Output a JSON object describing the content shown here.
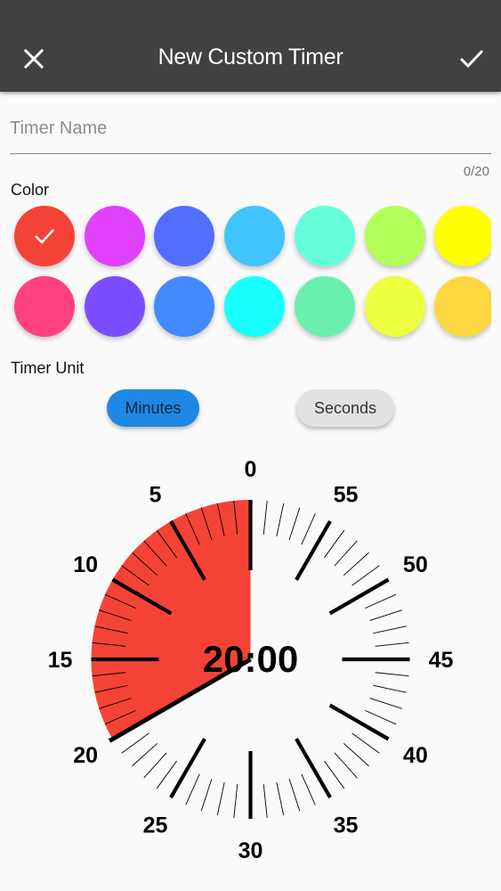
{
  "appbar": {
    "title": "New Custom Timer",
    "close_icon": "close-icon",
    "confirm_icon": "check-icon"
  },
  "form": {
    "name_placeholder": "Timer Name",
    "name_value": "",
    "counter": "0/20",
    "color_label": "Color",
    "unit_label": "Timer Unit"
  },
  "colors": {
    "selected_index": 0,
    "row1": [
      "#f44336",
      "#e040fb",
      "#536dfe",
      "#40c4ff",
      "#64ffda",
      "#b2ff59",
      "#ffff00"
    ],
    "row2": [
      "#ff4081",
      "#7c4dff",
      "#448aff",
      "#18ffff",
      "#69f0ae",
      "#eeff41",
      "#ffd740"
    ]
  },
  "units": {
    "minutes_label": "Minutes",
    "seconds_label": "Seconds",
    "selected": "Minutes"
  },
  "timer": {
    "display": "20:00",
    "minutes": 20,
    "max_minutes": 60,
    "fill_color": "#f44336",
    "dial_labels": [
      "0",
      "5",
      "10",
      "15",
      "20",
      "25",
      "30",
      "35",
      "40",
      "45",
      "50",
      "55"
    ]
  }
}
